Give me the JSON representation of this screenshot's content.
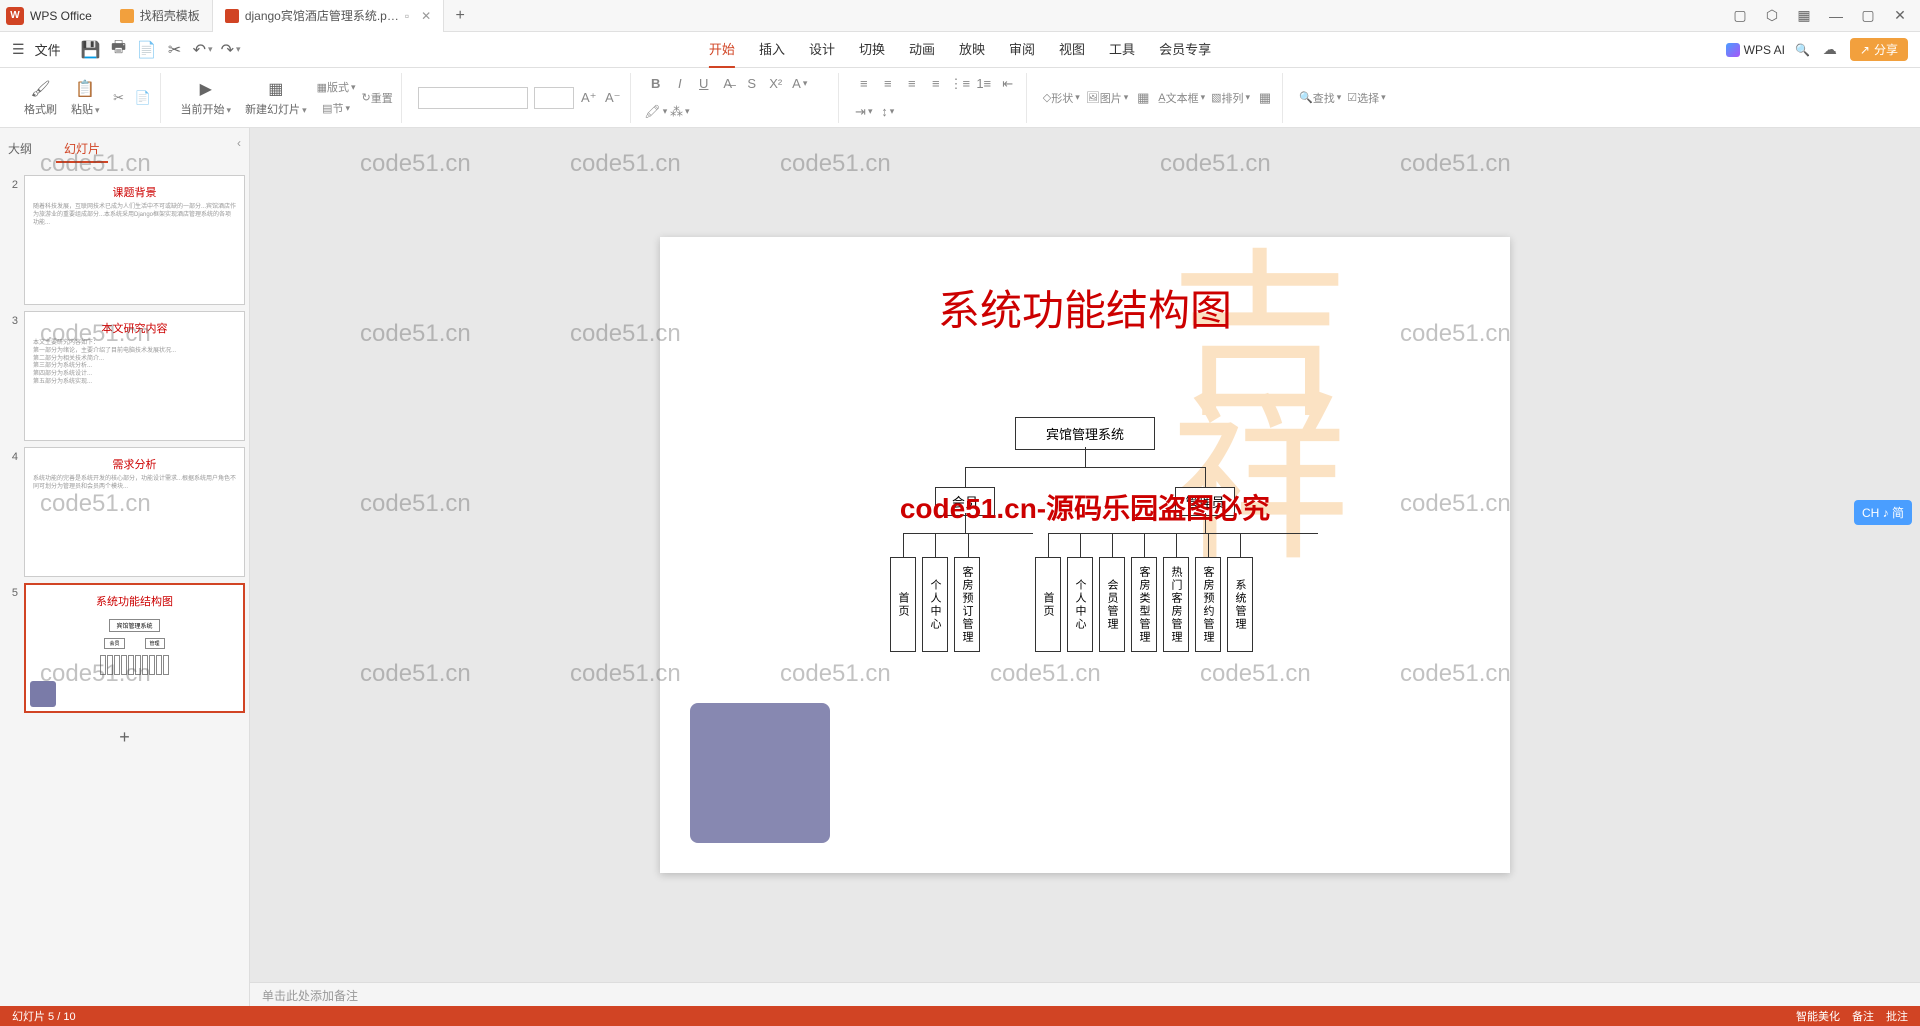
{
  "app": {
    "name": "WPS Office"
  },
  "tabs": [
    {
      "label": "找稻壳模板"
    },
    {
      "label": "django宾馆酒店管理系统.p…"
    }
  ],
  "titleRight": {
    "min": "—",
    "max": "▢",
    "close": "✕"
  },
  "menu": {
    "file": "文件",
    "main": [
      "开始",
      "插入",
      "设计",
      "切换",
      "动画",
      "放映",
      "审阅",
      "视图",
      "工具",
      "会员专享"
    ],
    "activeIndex": 0,
    "wpsai": "WPS AI",
    "share": "分享"
  },
  "ribbon": {
    "formatBrush": "格式刷",
    "paste": "粘贴",
    "begin": "当前开始",
    "newSlide": "新建幻灯片",
    "layout": "版式",
    "section": "节",
    "reset": "重置",
    "shape": "形状",
    "image": "图片",
    "textbox": "文本框",
    "arrange": "排列",
    "find": "查找",
    "select": "选择"
  },
  "sidebar": {
    "outline": "大纲",
    "slides": "幻灯片",
    "thumbs": [
      {
        "num": "2",
        "title": "课题背景"
      },
      {
        "num": "3",
        "title": "本文研究内容"
      },
      {
        "num": "4",
        "title": "需求分析"
      },
      {
        "num": "5",
        "title": "系统功能结构图"
      }
    ]
  },
  "slide": {
    "title": "系统功能结构图",
    "root": "宾馆管理系统",
    "l2": {
      "left": "会员",
      "right": "管理员"
    },
    "leftNodes": [
      "首页",
      "个人中心",
      "客房预订管理"
    ],
    "rightNodes": [
      "首页",
      "个人中心",
      "会员管理",
      "客房类型管理",
      "热门客房管理",
      "客房预约管理",
      "系统管理"
    ],
    "overlay": "code51.cn-源码乐园盗图必究"
  },
  "notes": "单击此处添加备注",
  "status": {
    "left": "幻灯片 5 / 10",
    "right": [
      "智能美化",
      "备注",
      "批注"
    ]
  },
  "ime": "CH ♪ 简",
  "watermark": "code51.cn"
}
